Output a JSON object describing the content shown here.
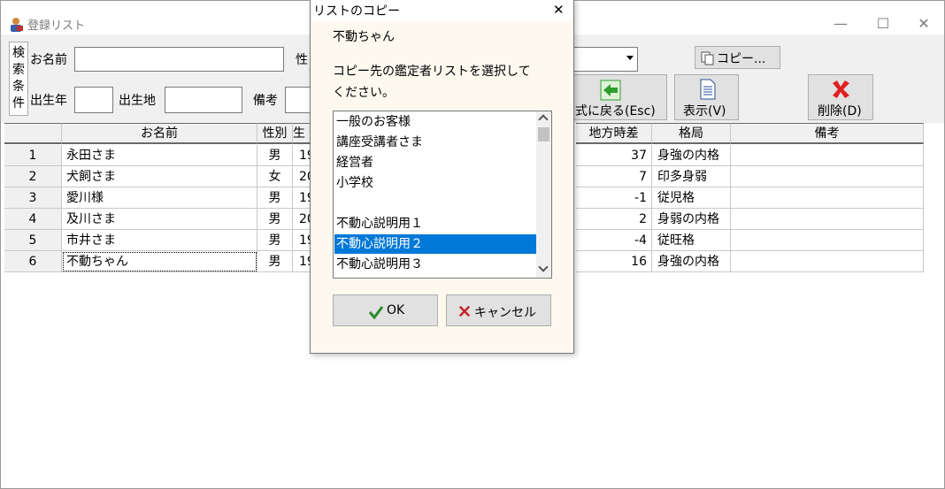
{
  "window": {
    "title": "登録リスト",
    "minimize": "—",
    "maximize": "☐",
    "close": "✕"
  },
  "search": {
    "condition_label": "検索条件",
    "name_label": "お名前",
    "sex_label": "性",
    "birth_year_label": "出生年",
    "birthplace_label": "出生地",
    "remarks_label": "備考",
    "name_value": "",
    "birth_year_value": "",
    "birthplace_value": "",
    "remarks_value": ""
  },
  "toolbar": {
    "copy_label": "コピー...",
    "back_label": "式に戻る(Esc)",
    "view_label": "表示(V)",
    "delete_label": "削除(D)"
  },
  "table": {
    "headers": {
      "name": "お名前",
      "sex": "性別",
      "col3": "生",
      "time_diff": "地方時差",
      "kakkyoku": "格局",
      "remarks": "備考"
    },
    "rows": [
      {
        "num": "1",
        "name": "永田さま",
        "sex": "男",
        "col3": "19",
        "time_diff": "37",
        "kakkyoku": "身強の内格",
        "remarks": ""
      },
      {
        "num": "2",
        "name": "犬飼さま",
        "sex": "女",
        "col3": "20",
        "time_diff": "7",
        "kakkyoku": "印多身弱",
        "remarks": ""
      },
      {
        "num": "3",
        "name": "愛川様",
        "sex": "男",
        "col3": "19",
        "time_diff": "-1",
        "kakkyoku": "従児格",
        "remarks": ""
      },
      {
        "num": "4",
        "name": "及川さま",
        "sex": "男",
        "col3": "20",
        "time_diff": "2",
        "kakkyoku": "身弱の内格",
        "remarks": ""
      },
      {
        "num": "5",
        "name": "市井さま",
        "sex": "男",
        "col3": "19",
        "time_diff": "-4",
        "kakkyoku": "従旺格",
        "remarks": ""
      },
      {
        "num": "6",
        "name": "不動ちゃん",
        "sex": "男",
        "col3": "19",
        "time_diff": "16",
        "kakkyoku": "身強の内格",
        "remarks": ""
      }
    ]
  },
  "dialog": {
    "title": "リストのコピー",
    "close": "✕",
    "subject_name": "不動ちゃん",
    "prompt_line1": "コピー先の鑑定者リストを選択して",
    "prompt_line2": "ください。",
    "list_items": [
      "一般のお客様",
      "講座受講者さま",
      "経営者",
      "小学校",
      "",
      "不動心説明用１",
      "不動心説明用２",
      "不動心説明用３"
    ],
    "selected_index": 6,
    "ok_label": "OK",
    "cancel_label": "キャンセル"
  },
  "colors": {
    "selection": "#0078d7",
    "dialog_bg": "#fdf9ef",
    "ok_check": "#2a8a2a",
    "cancel_x": "#c0282d",
    "delete_x": "#e02020",
    "back_arrow": "#2e9e2e"
  }
}
